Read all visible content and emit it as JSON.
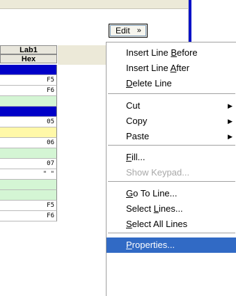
{
  "toolbar": {
    "edit_label": "Edit",
    "edit_arrow": "»"
  },
  "grid": {
    "header1": "Lab1",
    "header2": "Hex",
    "rows": [
      {
        "style": "blue",
        "value": ""
      },
      {
        "style": "white",
        "value": "F5"
      },
      {
        "style": "white",
        "value": "F6"
      },
      {
        "style": "green",
        "value": ""
      },
      {
        "style": "blue",
        "value": ""
      },
      {
        "style": "white",
        "value": "05"
      },
      {
        "style": "yellow",
        "value": ""
      },
      {
        "style": "white",
        "value": "06"
      },
      {
        "style": "green",
        "value": ""
      },
      {
        "style": "white",
        "value": "07"
      },
      {
        "style": "white",
        "value": "\" \""
      },
      {
        "style": "green",
        "value": ""
      },
      {
        "style": "green",
        "value": ""
      },
      {
        "style": "white",
        "value": "F5"
      },
      {
        "style": "white",
        "value": "F6"
      }
    ]
  },
  "menu": {
    "items": [
      {
        "name": "insert-line-before",
        "pre": "Insert Line ",
        "u": "B",
        "post": "efore"
      },
      {
        "name": "insert-line-after",
        "pre": "Insert Line ",
        "u": "A",
        "post": "fter"
      },
      {
        "name": "delete-line",
        "pre": "",
        "u": "D",
        "post": "elete Line"
      },
      {
        "name": "cut",
        "pre": "Cut",
        "u": "",
        "post": "",
        "sub": "▶"
      },
      {
        "name": "copy",
        "pre": "Copy",
        "u": "",
        "post": "",
        "sub": "▶"
      },
      {
        "name": "paste",
        "pre": "Paste",
        "u": "",
        "post": "",
        "sub": "▶"
      },
      {
        "name": "fill",
        "pre": "",
        "u": "F",
        "post": "ill..."
      },
      {
        "name": "show-keypad",
        "pre": "Show Keypad...",
        "u": "",
        "post": ""
      },
      {
        "name": "go-to-line",
        "pre": "",
        "u": "G",
        "post": "o To Line..."
      },
      {
        "name": "select-lines",
        "pre": "Select ",
        "u": "L",
        "post": "ines..."
      },
      {
        "name": "select-all-lines",
        "pre": "",
        "u": "S",
        "post": "elect All Lines"
      },
      {
        "name": "properties",
        "pre": "",
        "u": "P",
        "post": "roperties..."
      }
    ]
  }
}
